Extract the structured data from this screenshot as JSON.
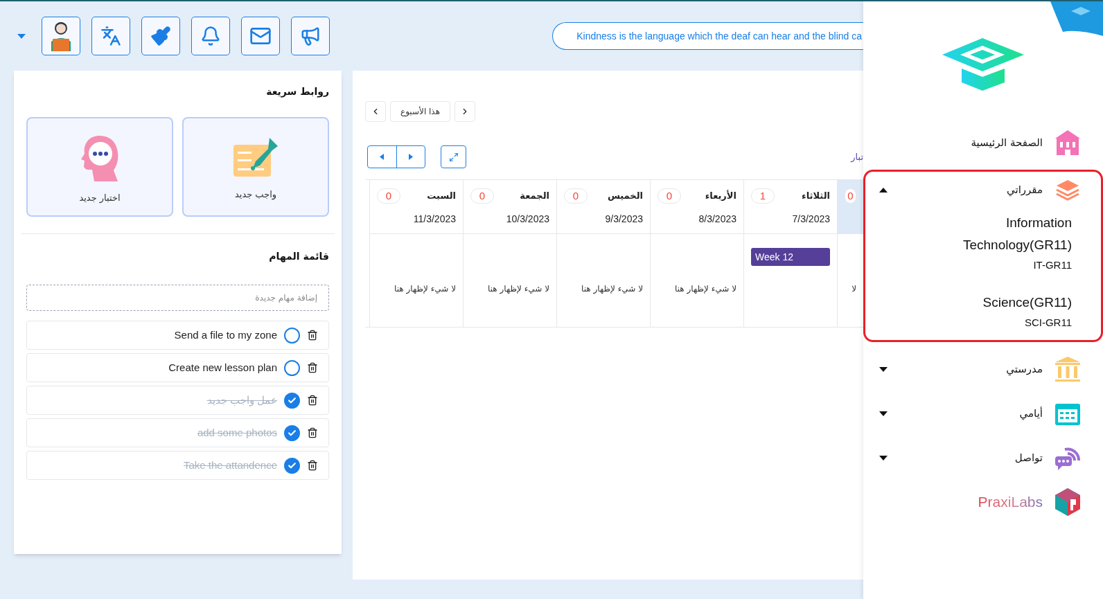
{
  "quote": {
    "text": "Kindness is the language which the deaf can hear and the blind ca"
  },
  "quick_links": {
    "title": "روابط سريعة",
    "items": [
      {
        "kind": "assignment",
        "label": "واجب جديد"
      },
      {
        "kind": "quiz",
        "label": "اختبار جديد"
      }
    ]
  },
  "tasks": {
    "title": "قائمة المهام",
    "placeholder": "إضافة مهام جديدة",
    "items": [
      {
        "text": "Send a file to my zone",
        "checked": false
      },
      {
        "text": "Create new lesson plan",
        "checked": false
      },
      {
        "text": "عمل واجب جديد",
        "checked": true
      },
      {
        "text": "add some photos",
        "checked": true
      },
      {
        "text": "Take the attandence",
        "checked": true
      }
    ]
  },
  "calendar": {
    "week_button": "هذا الأسبوع",
    "filter_text": "تبار",
    "days": [
      {
        "selected": true,
        "count": "0",
        "empty_text": "لا"
      },
      {
        "selected": false,
        "name": "الثلاثاء",
        "count": "1",
        "date": "7/3/2023",
        "events": [
          {
            "title": "Week 12",
            "color": "#553f99"
          }
        ]
      },
      {
        "selected": false,
        "name": "الأربعاء",
        "count": "0",
        "date": "8/3/2023",
        "empty_text": "لا شيء لإظهار هنا"
      },
      {
        "selected": false,
        "name": "الخميس",
        "count": "0",
        "date": "9/3/2023",
        "empty_text": "لا شيء لإظهار هنا"
      },
      {
        "selected": false,
        "name": "الجمعة",
        "count": "0",
        "date": "10/3/2023",
        "empty_text": "لا شيء لإظهار هنا"
      },
      {
        "selected": false,
        "name": "السبت",
        "count": "0",
        "date": "11/3/2023",
        "empty_text": "لا شيء لإظهار هنا"
      }
    ]
  },
  "sidebar": {
    "items": [
      {
        "kind": "link",
        "label": "الصفحة الرئيسية"
      },
      {
        "kind": "group",
        "label": "مقرراتي",
        "expanded": true,
        "children": [
          {
            "title": "Information Technology(GR11)",
            "code": "IT-GR11"
          },
          {
            "title": "Science(GR11)",
            "code": "SCI-GR11"
          }
        ]
      },
      {
        "kind": "group",
        "label": "مدرستي",
        "expanded": false
      },
      {
        "kind": "group",
        "label": "أيامي",
        "expanded": false
      },
      {
        "kind": "group",
        "label": "تواصل",
        "expanded": false
      },
      {
        "kind": "brand",
        "label": "PraxiLabs"
      }
    ]
  }
}
